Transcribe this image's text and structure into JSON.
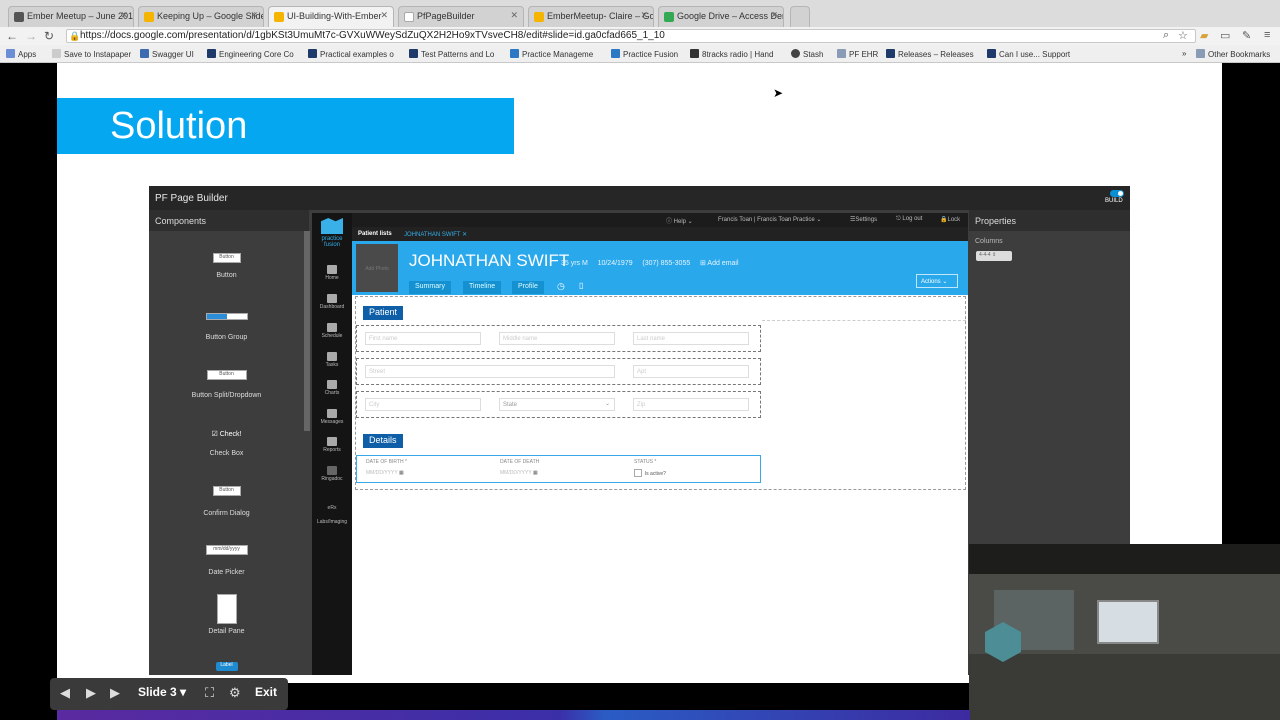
{
  "browser": {
    "tabs": [
      {
        "label": "Ember Meetup – June 201",
        "favicon_color": "#555555"
      },
      {
        "label": "Keeping Up – Google Slide",
        "favicon_color": "#f4b400"
      },
      {
        "label": "UI-Building-With-Ember",
        "favicon_color": "#f4b400"
      },
      {
        "label": "PfPageBuilder",
        "favicon_color": "#ffffff"
      },
      {
        "label": "EmberMeetup- Claire – Go",
        "favicon_color": "#f4b400"
      },
      {
        "label": "Google Drive – Access Den",
        "favicon_color": "#34a853"
      }
    ],
    "url": "https://docs.google.com/presentation/d/1gbKSt3UmuMt7c-GVXuWWeySdZuQX2H2Ho9xTVsveCH8/edit#slide=id.ga0cfad665_1_10",
    "bookmarks": [
      "Apps",
      "Save to Instapaper",
      "Swagger UI",
      "Engineering Core Co",
      "Practical examples o",
      "Test Patterns and Lo",
      "Practice Manageme",
      "Practice Fusion",
      "8tracks radio | Hand",
      "Stash",
      "PF EHR",
      "Releases – Releases",
      "Can I use... Support",
      "Other Bookmarks"
    ]
  },
  "slide": {
    "title": "Solution",
    "accent_color": "#05a8f0"
  },
  "app": {
    "title": "PF Page Builder",
    "build_label": "BUILD",
    "components_header": "Components",
    "properties_header": "Properties",
    "columns_label": "Columns",
    "columns_value": "4-4-4",
    "components": [
      {
        "label": "Button",
        "preview": "Button"
      },
      {
        "label": "Button Group",
        "preview": ""
      },
      {
        "label": "Button Split/Dropdown",
        "preview": "Button"
      },
      {
        "label": "Check Box",
        "preview": "Check!"
      },
      {
        "label": "Confirm Dialog",
        "preview": "Button"
      },
      {
        "label": "Date Picker",
        "preview": "mm/dd/yyyy"
      },
      {
        "label": "Detail Pane",
        "preview": ""
      },
      {
        "label": "",
        "preview": "Label"
      }
    ]
  },
  "ehr": {
    "logo_text": "practice fusion",
    "rail": [
      "Home",
      "Dashboard",
      "Schedule",
      "Tasks",
      "Charts",
      "Messages",
      "Reports",
      "Ringadoc",
      "eRx",
      "Labs/Imaging"
    ],
    "topnav": {
      "help": "Help",
      "user": "Francis Toan | Francis Toan Practice",
      "settings": "Settings",
      "logout": "Log out",
      "lock": "Lock"
    },
    "patient_lists": "Patient lists",
    "open_tab": "JOHNATHAN SWIFT",
    "patient": {
      "name": "JOHNATHAN SWIFT",
      "age_sex": "35 yrs M",
      "dob": "10/24/1979",
      "phone": "(307) 855-3055",
      "add_email": "Add email",
      "photo_label": "Add Photo",
      "tabs": [
        "Summary",
        "Timeline",
        "Profile"
      ],
      "actions": "Actions"
    },
    "sections": {
      "patient": "Patient",
      "details": "Details"
    },
    "fields": {
      "first_name": "First name",
      "middle_name": "Middle name",
      "last_name": "Last name",
      "street": "Street",
      "apt": "Apt",
      "city": "City",
      "state": "State",
      "zip": "Zip",
      "dob_label": "DATE OF BIRTH *",
      "dod_label": "DATE OF DEATH",
      "status_label": "STATUS *",
      "date_placeholder": "MM/DD/YYYY",
      "is_active": "Is active?"
    }
  },
  "presenter": {
    "slide_label": "Slide 3",
    "exit_label": "Exit"
  }
}
